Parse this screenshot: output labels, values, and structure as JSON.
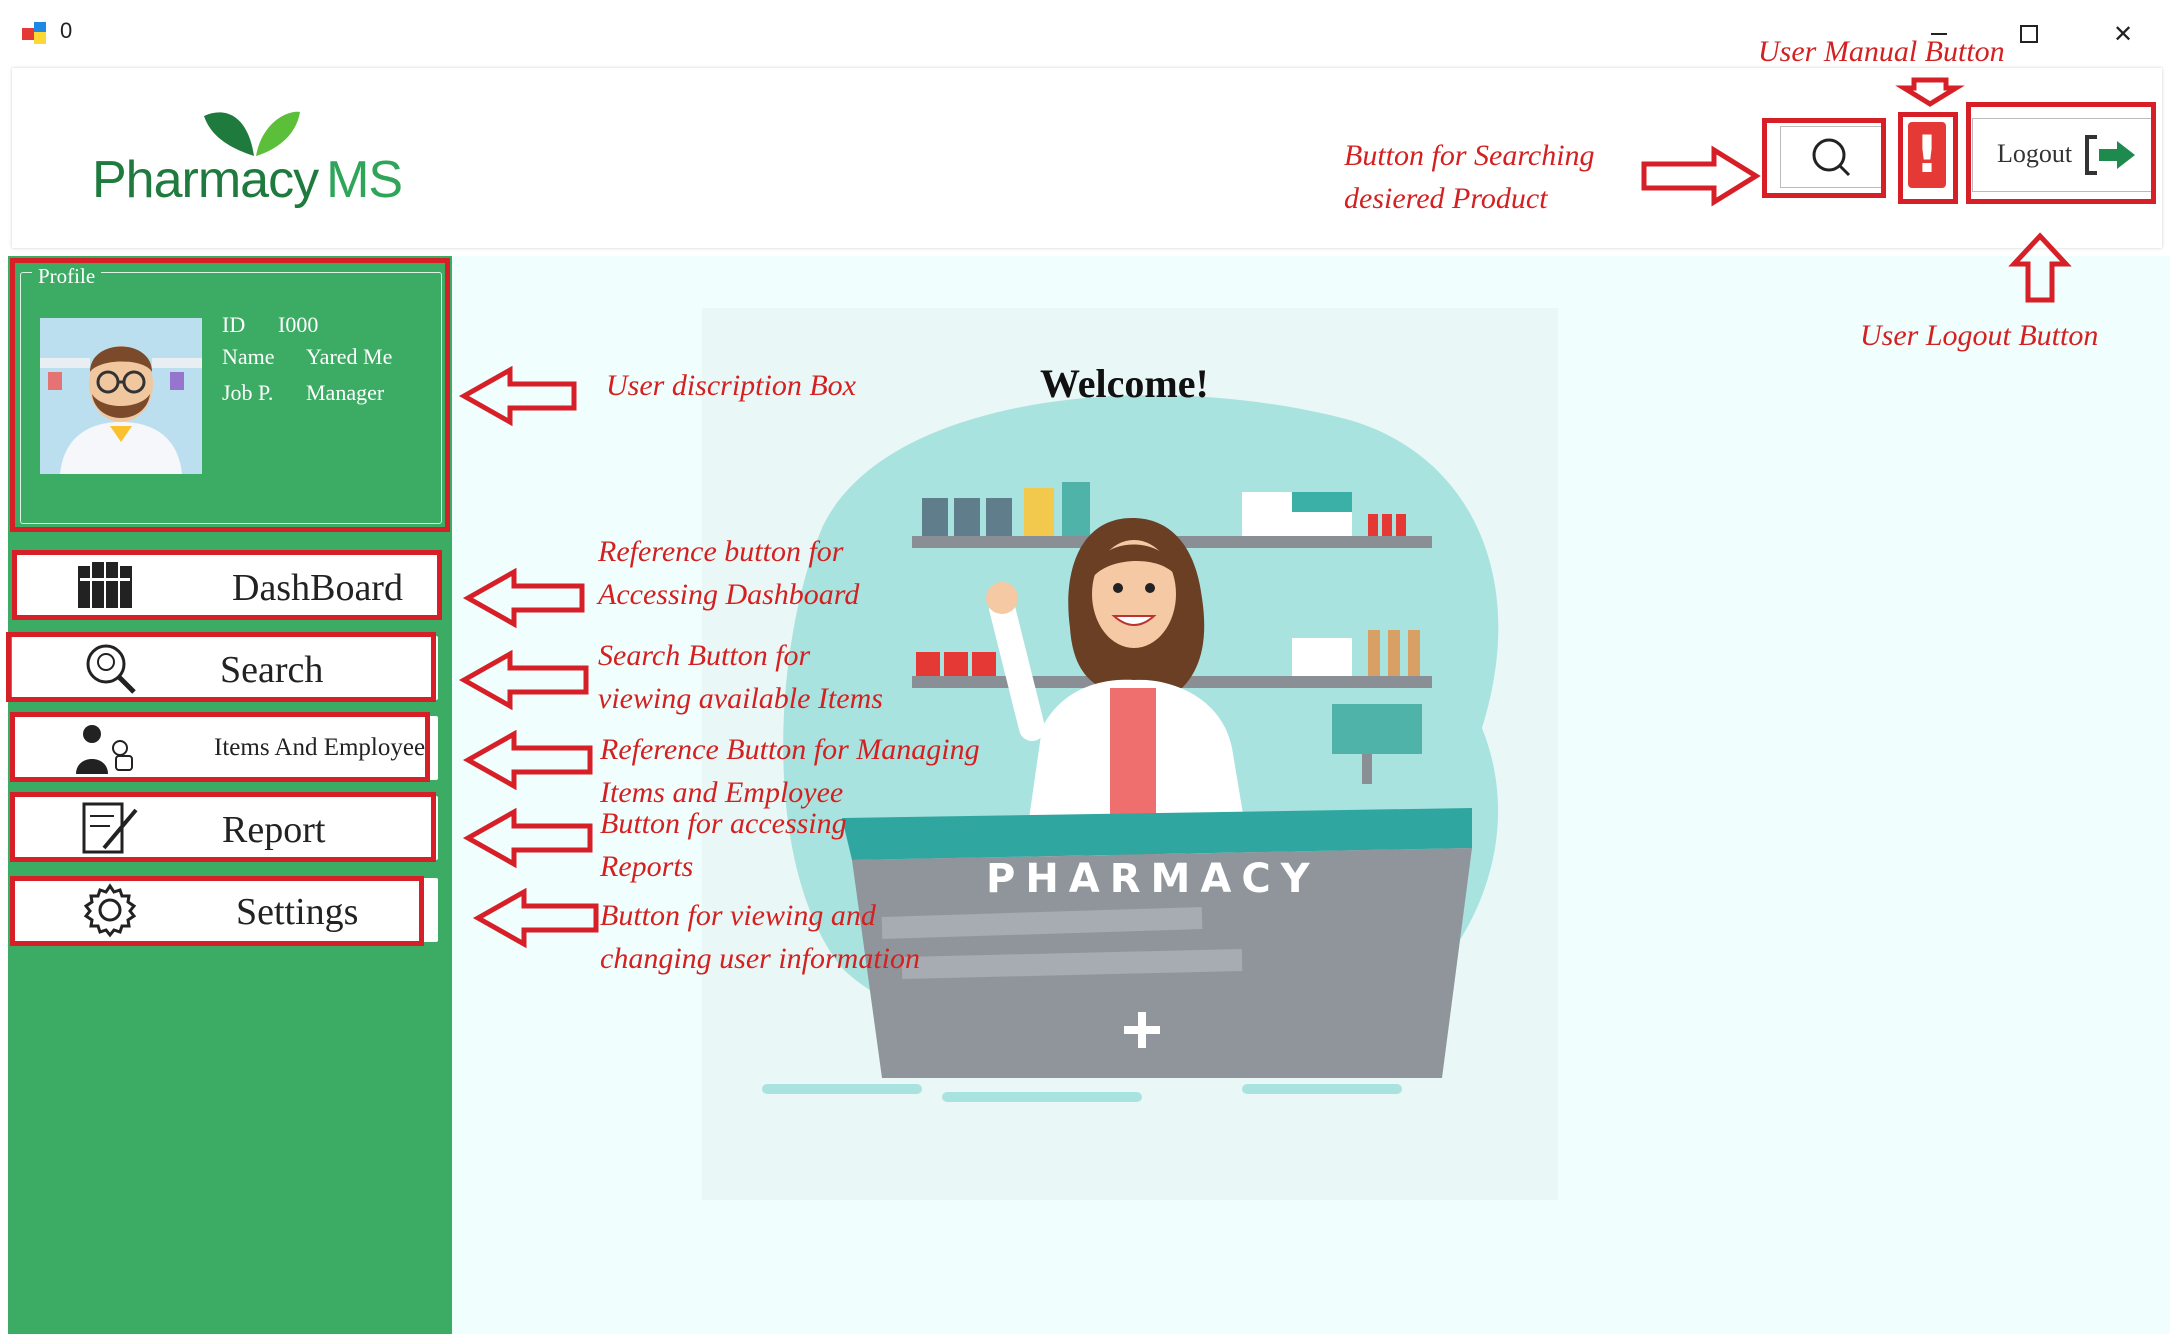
{
  "window": {
    "title": "0",
    "minimize_icon": "minimize-icon",
    "maximize_icon": "maximize-icon",
    "close_icon": "close-icon",
    "close_glyph": "✕"
  },
  "header": {
    "logo_main": "Pharmacy",
    "logo_suffix": "MS",
    "search_icon": "search-icon",
    "manual_glyph": "!",
    "logout_label": "Logout",
    "logout_icon": "logout-icon"
  },
  "profile": {
    "legend": "Profile",
    "id_label": "ID",
    "id_value": "I000",
    "name_label": "Name",
    "name_value": "Yared Me",
    "job_label": "Job P.",
    "job_value": "Manager"
  },
  "nav": [
    {
      "label": "DashBoard",
      "icon": "dashboard-icon"
    },
    {
      "label": "Search",
      "icon": "search-icon"
    },
    {
      "label": "Items And Employee",
      "icon": "employee-icon"
    },
    {
      "label": "Report",
      "icon": "report-icon"
    },
    {
      "label": "Settings",
      "icon": "gear-icon"
    }
  ],
  "main": {
    "welcome": "Welcome!",
    "sign": "PHARMACY"
  },
  "annotations": {
    "user_manual": "User Manual Button",
    "search_1": "Button for Searching",
    "search_2": "desiered Product",
    "logout": "User Logout Button",
    "profile": "User discription Box",
    "dashboard_1": "Reference button for",
    "dashboard_2": "Accessing Dashboard",
    "search_nav_1": "Search Button for",
    "search_nav_2": "viewing available Items",
    "items_1": "Reference Button for Managing",
    "items_2": "Items and Employee",
    "report_1": "Button for accessing",
    "report_2": "Reports",
    "settings_1": "Button for viewing and",
    "settings_2": "changing user information"
  },
  "colors": {
    "sidebar": "#3cab64",
    "annotation": "#d42020",
    "main_bg": "#f0fefd",
    "manual": "#e53935"
  }
}
